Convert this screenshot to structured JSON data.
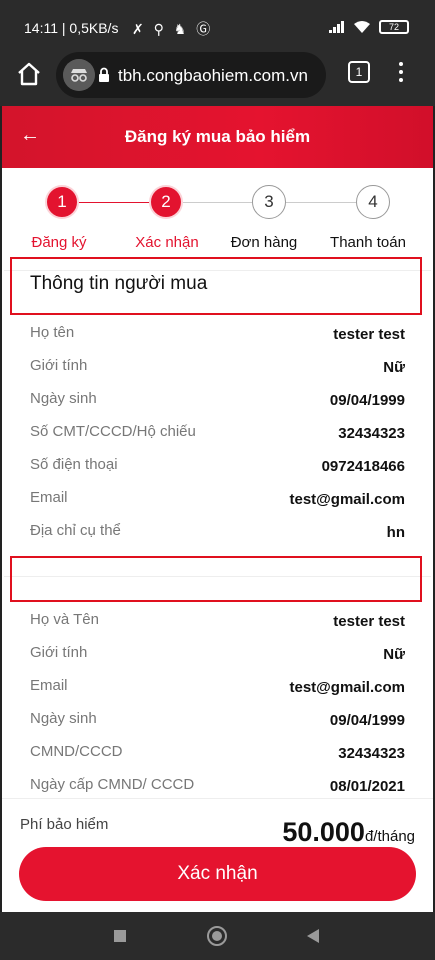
{
  "status_bar": {
    "time_speed": "14:11 | 0,5KB/s",
    "battery": "72"
  },
  "browser": {
    "url": "tbh.congbaohiem.com.vn",
    "tab_count": "1"
  },
  "header": {
    "title": "Đăng ký mua bảo hiểm"
  },
  "steps": [
    {
      "number": "1",
      "label": "Đăng ký",
      "state": "active"
    },
    {
      "number": "2",
      "label": "Xác nhận",
      "state": "active"
    },
    {
      "number": "3",
      "label": "Đơn hàng",
      "state": "inactive"
    },
    {
      "number": "4",
      "label": "Thanh toán",
      "state": "inactive"
    }
  ],
  "buyer_section": {
    "title": "Thông tin người mua",
    "rows": [
      {
        "label": "Họ tên",
        "value": "tester test"
      },
      {
        "label": "Giới tính",
        "value": "Nữ"
      },
      {
        "label": "Ngày sinh",
        "value": "09/04/1999"
      },
      {
        "label": "Số CMT/CCCD/Hộ chiếu",
        "value": "32434323"
      },
      {
        "label": "Số điện thoại",
        "value": "0972418466"
      },
      {
        "label": "Email",
        "value": "test@gmail.com"
      },
      {
        "label": "Địa chỉ cụ thể",
        "value": "hn"
      }
    ]
  },
  "insured_section": {
    "title": "",
    "rows": [
      {
        "label": "Họ và Tên",
        "value": "tester test"
      },
      {
        "label": "Giới tính",
        "value": "Nữ"
      },
      {
        "label": "Email",
        "value": "test@gmail.com"
      },
      {
        "label": "Ngày sinh",
        "value": "09/04/1999"
      },
      {
        "label": "CMND/CCCD",
        "value": "32434323"
      },
      {
        "label": "Ngày cấp CMND/ CCCD",
        "value": "08/01/2021"
      }
    ]
  },
  "footer": {
    "fee_label": "Phí bảo hiểm",
    "fee_amount": "50.000",
    "fee_unit": "đ/tháng",
    "confirm_label": "Xác nhận"
  },
  "colors": {
    "primary": "#e5132f",
    "highlight_border": "#e0101e"
  }
}
